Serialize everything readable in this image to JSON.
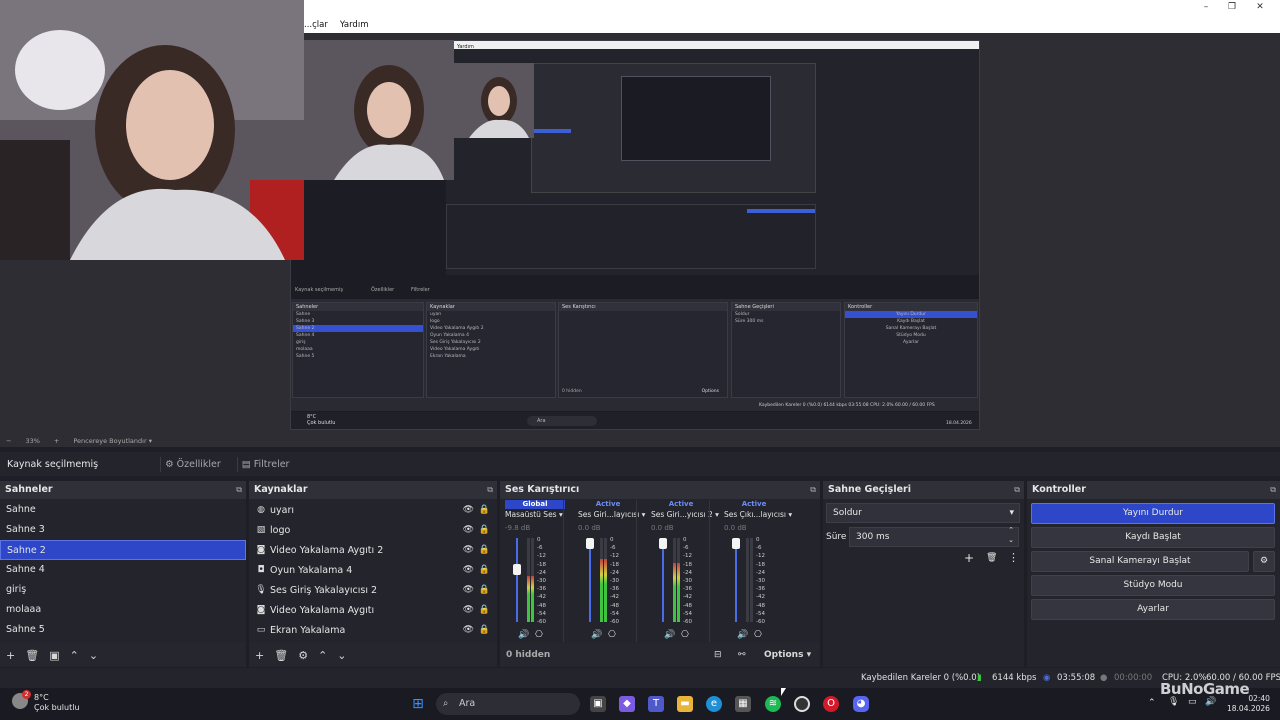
{
  "menu": {
    "items": [
      "...çlar",
      "Yardım"
    ]
  },
  "preview": {
    "inner_menu": "Yardım",
    "inner_scenes_title": "Sahneler",
    "inner_sources_title": "Kaynaklar",
    "inner_mixer_title": "Ses Karıştırıcı",
    "inner_transitions_title": "Sahne Geçişleri",
    "inner_controls_title": "Kontroller",
    "inner_scenes": [
      "Sahne",
      "Sahne 3",
      "Sahne 2",
      "Sahne 4",
      "giriş",
      "molaaa",
      "Sahne 5"
    ],
    "inner_sources": [
      "uyarı",
      "logo",
      "Video Yakalama Aygıtı 2",
      "Oyun Yakalama 4",
      "Ses Giriş Yakalayıcısı 2",
      "Video Yakalama Aygıtı",
      "Ekran Yakalama"
    ],
    "inner_controls": [
      "Yayını Durdur",
      "Kaydı Başlat",
      "Sanal Kamerayı Başlat",
      "Stüdyo Modu",
      "Ayarlar"
    ],
    "inner_nosel": "Kaynak seçilmemiş",
    "inner_props": "Özellikler",
    "inner_filters": "Filtreler",
    "inner_transition": "Soldur",
    "inner_duration_label": "Süre",
    "inner_duration": "300 ms",
    "inner_hidden": "0 hidden",
    "inner_options": "Options",
    "inner_status": "Kaybedilen Kareler 0 (%0.0)   6144 kbps   03:55:08   CPU: 2.0%   60.00 / 60.00 FPS",
    "inner_weather_temp": "8°C",
    "inner_weather": "Çok bulutlu",
    "inner_search": "Ara",
    "inner_date": "18.04.2026"
  },
  "zoom": {
    "minus": "−",
    "value": "33%",
    "plus": "+",
    "mode": "Pencereye Boyutlandır"
  },
  "source_toolbar": {
    "no_selection": "Kaynak seçilmemiş",
    "properties": "Özellikler",
    "filters": "Filtreler"
  },
  "scenes": {
    "title": "Sahneler",
    "items": [
      "Sahne",
      "Sahne 3",
      "Sahne 2",
      "Sahne 4",
      "giriş",
      "molaaa",
      "Sahne 5"
    ],
    "selected_index": 2
  },
  "sources": {
    "title": "Kaynaklar",
    "items": [
      {
        "label": "uyarı",
        "icon": "globe-icon"
      },
      {
        "label": "logo",
        "icon": "image-icon"
      },
      {
        "label": "Video Yakalama Aygıtı 2",
        "icon": "camera-icon"
      },
      {
        "label": "Oyun Yakalama 4",
        "icon": "gamepad-icon"
      },
      {
        "label": "Ses Giriş Yakalayıcısı 2",
        "icon": "microphone-icon"
      },
      {
        "label": "Video Yakalama Aygıtı",
        "icon": "camera-icon"
      },
      {
        "label": "Ekran Yakalama",
        "icon": "monitor-icon"
      }
    ]
  },
  "mixer": {
    "title": "Ses Karıştırıcı",
    "channels": [
      {
        "tag": "Global",
        "name": "Masaüstü Ses",
        "db": "-9.8 dB",
        "level": 0.55
      },
      {
        "tag": "Active",
        "name": "Ses Giri...layıcısı",
        "db": "0.0 dB",
        "level": 0.75
      },
      {
        "tag": "Active",
        "name": "Ses Giri...yıcısı 2",
        "db": "0.0 dB",
        "level": 0.7
      },
      {
        "tag": "Active",
        "name": "Ses Çıkı...layıcısı",
        "db": "0.0 dB",
        "level": 0.0
      }
    ],
    "ticks": [
      "0",
      "-6",
      "-12",
      "-18",
      "-24",
      "-30",
      "-36",
      "-42",
      "-48",
      "-54",
      "-60"
    ],
    "hidden": "0 hidden",
    "options": "Options"
  },
  "transitions": {
    "title": "Sahne Geçişleri",
    "transition": "Soldur",
    "duration_label": "Süre",
    "duration": "300 ms"
  },
  "controls": {
    "title": "Kontroller",
    "stop_stream": "Yayını Durdur",
    "start_record": "Kaydı Başlat",
    "start_virtualcam": "Sanal Kamerayı Başlat",
    "studio_mode": "Stüdyo Modu",
    "settings": "Ayarlar"
  },
  "status": {
    "dropped": "Kaybedilen Kareler 0 (%0.0)",
    "bitrate": "6144 kbps",
    "stream_time": "03:55:08",
    "rec_time": "00:00:00",
    "cpu": "CPU: 2.0%",
    "fps": "60.00 / 60.00 FPS"
  },
  "taskbar": {
    "weather_temp": "8°C",
    "weather_desc": "Çok bulutlu",
    "weather_badge": "2",
    "search_placeholder": "Ara",
    "clock_time": "02:40",
    "clock_date": "18.04.2026",
    "watermark": "BuNoGame"
  },
  "colors": {
    "accent": "#2d47c8",
    "meter_green": "#3fc43f",
    "active_blue": "#6d8cf5"
  }
}
